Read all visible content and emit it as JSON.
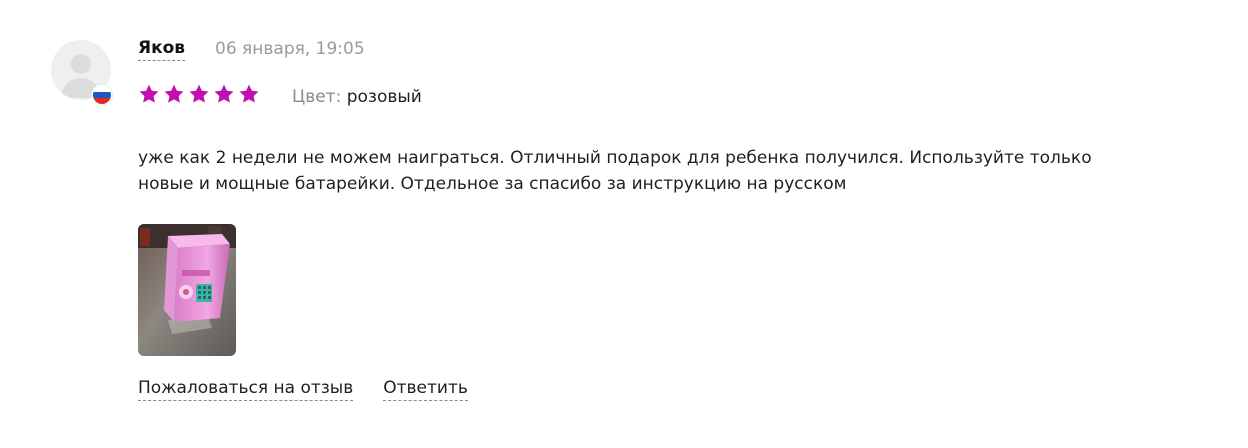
{
  "review": {
    "author": "Яков",
    "date": "06 января, 19:05",
    "rating": 5,
    "rating_max": 5,
    "star_color": "#c20eb0",
    "variant_label": "Цвет:",
    "variant_value": "розовый",
    "text": "уже как 2 недели не можем наиграться. Отличный подарок для ребенка получился. Используйте только новые и мощные батарейки. Отдельное за спасибо за инструкцию на русском",
    "country_flag": "russia-flag-icon",
    "photos": [
      {
        "name": "review-photo",
        "depicts": "pink toy safe"
      }
    ]
  },
  "actions": {
    "complain_label": "Пожаловаться на отзыв",
    "reply_label": "Ответить"
  }
}
